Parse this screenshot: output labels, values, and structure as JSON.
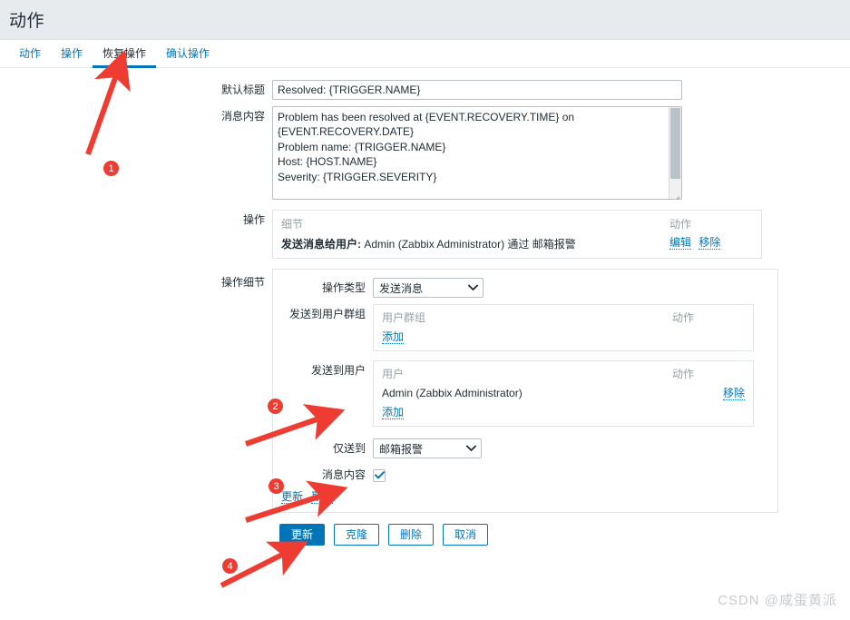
{
  "header": {
    "title": "动作"
  },
  "tabs": [
    {
      "label": "动作",
      "active": false
    },
    {
      "label": "操作",
      "active": false
    },
    {
      "label": "恢复操作",
      "active": true
    },
    {
      "label": "确认操作",
      "active": false
    }
  ],
  "form": {
    "default_subject": {
      "label": "默认标题",
      "value": "Resolved: {TRIGGER.NAME}"
    },
    "message": {
      "label": "消息内容",
      "value": "Problem has been resolved at {EVENT.RECOVERY.TIME} on\n{EVENT.RECOVERY.DATE}\nProblem name: {TRIGGER.NAME}\nHost: {HOST.NAME}\nSeverity: {TRIGGER.SEVERITY}\n\nOriginal problem ID: {EVENT.ID}\n{TRIGGER.URL}"
    },
    "operations": {
      "label": "操作",
      "columns": [
        "细节",
        "动作"
      ],
      "rows": [
        {
          "detail_bold": "发送消息给用户:",
          "detail_rest": "Admin (Zabbix Administrator) 通过 邮箱报警",
          "edit_label": "编辑",
          "remove_label": "移除"
        }
      ]
    },
    "operation_details": {
      "label": "操作细节",
      "operation_type": {
        "label": "操作类型",
        "value": "发送消息"
      },
      "send_to_user_groups": {
        "label": "发送到用户群组",
        "columns": [
          "用户群组",
          "动作"
        ],
        "rows": [],
        "add_label": "添加"
      },
      "send_to_users": {
        "label": "发送到用户",
        "columns": [
          "用户",
          "动作"
        ],
        "rows": [
          {
            "name": "Admin (Zabbix Administrator)",
            "remove_label": "移除"
          }
        ],
        "add_label": "添加"
      },
      "send_only_to": {
        "label": "仅送到",
        "value": "邮箱报警"
      },
      "message_content": {
        "label": "消息内容",
        "checked": true
      },
      "update_label": "更新",
      "cancel_label": "取消"
    }
  },
  "footer": {
    "buttons": [
      {
        "label": "更新",
        "primary": true
      },
      {
        "label": "克隆",
        "primary": false
      },
      {
        "label": "删除",
        "primary": false
      },
      {
        "label": "取消",
        "primary": false
      }
    ]
  },
  "annotations": {
    "markers": [
      {
        "number": "1"
      },
      {
        "number": "2"
      },
      {
        "number": "3"
      },
      {
        "number": "4"
      }
    ],
    "color": "#ef3c33"
  },
  "watermark": {
    "text": "CSDN @咸蛋黄派"
  }
}
